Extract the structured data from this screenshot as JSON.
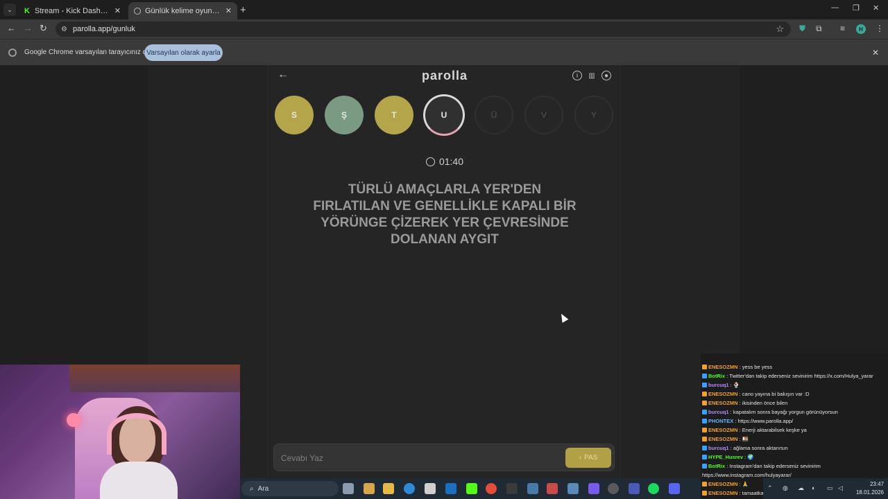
{
  "browser": {
    "tabs": [
      {
        "title": "Stream - Kick Dashboard",
        "icon": "kick-icon",
        "active": false
      },
      {
        "title": "Günlük kelime oyunu - parolla",
        "icon": "globe-icon",
        "active": true
      }
    ],
    "url": "parolla.app/gunluk",
    "infobar": {
      "message": "Google Chrome varsayılan tarayıcınız değil",
      "button": "Varsayılan olarak ayarla"
    },
    "profile_initial": "H",
    "accent": "#a8c0dc"
  },
  "game": {
    "logo": "parolla",
    "letters": [
      {
        "char": "S",
        "state": "yellow"
      },
      {
        "char": "Ş",
        "state": "green"
      },
      {
        "char": "T",
        "state": "yellow"
      },
      {
        "char": "U",
        "state": "current"
      },
      {
        "char": "Ü",
        "state": "pending"
      },
      {
        "char": "V",
        "state": "pending"
      },
      {
        "char": "Y",
        "state": "pending"
      }
    ],
    "timer": "01:40",
    "question": "TÜRLÜ AMAÇLARLA YER'DEN FIRLATILAN VE GENELLİKLE KAPALI BİR YÖRÜNGE ÇİZEREK YER ÇEVRESİNDE DOLANAN AYGIT",
    "answer_placeholder": "Cevabı Yaz",
    "pass_label": "PAS",
    "colors": {
      "yellow": "#b5a54a",
      "green": "#7a9a83",
      "pass": "#b2a046"
    }
  },
  "taskbar": {
    "search_label": "Ara",
    "time": "23:47",
    "date": "18.01.2026"
  },
  "chat": [
    {
      "user": "ENESOZMN",
      "color": "#f0a030",
      "msg": "yess be yess"
    },
    {
      "user": "BotRix",
      "color": "#53fc18",
      "msg": "Twitter'dan takip ederseniz sevinirim https://x.com/Hulya_yarar"
    },
    {
      "user": "burcuq1",
      "color": "#b48cff",
      "msg": "🍨"
    },
    {
      "user": "ENESOZMN",
      "color": "#f0a030",
      "msg": "cano yayına bi bakışın var :D"
    },
    {
      "user": "ENESOZMN",
      "color": "#f0a030",
      "msg": "ikisinden önce bilen"
    },
    {
      "user": "burcuq1",
      "color": "#b48cff",
      "msg": "kapatalım sonra bayağı yorgun görünüyorsun"
    },
    {
      "user": "PHONTEX",
      "color": "#6ab4ff",
      "msg": "https://www.parolla.app/"
    },
    {
      "user": "ENESOZMN",
      "color": "#f0a030",
      "msg": "Enerji aktarabilsek keşke ya"
    },
    {
      "user": "ENESOZMN",
      "color": "#f0a030",
      "msg": "🍱"
    },
    {
      "user": "burcuq1",
      "color": "#b48cff",
      "msg": "ağlama sonra aktarırsın"
    },
    {
      "user": "HYPE_Husrev",
      "color": "#53fc18",
      "msg": "🌍"
    },
    {
      "user": "BotRix",
      "color": "#53fc18",
      "msg": "Instagram'dan takip ederseniz sevinirim"
    },
    {
      "user": "",
      "color": "#e6e6e6",
      "msg": "https://www.instagram.com/hulyayarar/"
    },
    {
      "user": "ENESOZMN",
      "color": "#f0a030",
      "msg": "🙏"
    },
    {
      "user": "ENESOZMN",
      "color": "#f0a030",
      "msg": "tamaatkar"
    }
  ]
}
